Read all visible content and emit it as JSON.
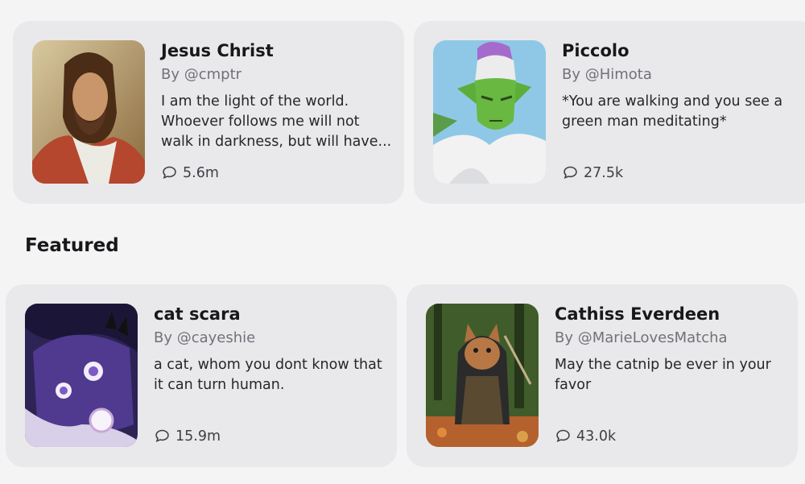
{
  "top_cards": [
    {
      "title": "Jesus Christ",
      "author": "By @cmptr",
      "description": "I am the light of the world. Whoever follows me will not walk in darkness, but will have...",
      "chats": "5.6m"
    },
    {
      "title": "Piccolo",
      "author": "By @Himota",
      "description": "*You are walking and you see a green man meditating*",
      "chats": "27.5k"
    }
  ],
  "featured": {
    "heading": "Featured",
    "cards": [
      {
        "title": "cat scara",
        "author": "By @cayeshie",
        "description": "a cat, whom you dont know that it can turn human.",
        "chats": "15.9m"
      },
      {
        "title": "Cathiss Everdeen",
        "author": "By @MarieLovesMatcha",
        "description": "May the catnip be ever in your favor",
        "chats": "43.0k"
      }
    ]
  },
  "icons": {
    "chat": "chat-bubble-icon"
  }
}
